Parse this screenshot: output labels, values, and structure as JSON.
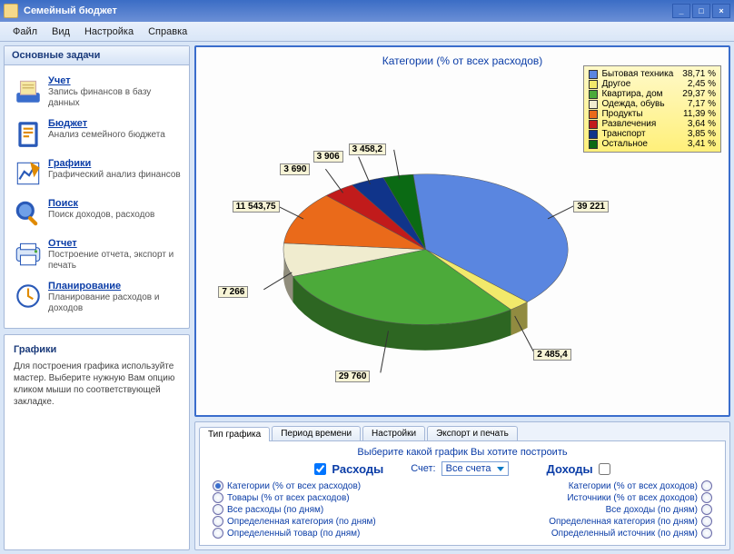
{
  "window": {
    "title": "Семейный бюджет"
  },
  "menu": {
    "items": [
      "Файл",
      "Вид",
      "Настройка",
      "Справка"
    ]
  },
  "tasks_panel": {
    "title": "Основные задачи",
    "items": [
      {
        "title": "Учет",
        "desc": "Запись финансов в базу данных"
      },
      {
        "title": "Бюджет",
        "desc": "Анализ семейного бюджета"
      },
      {
        "title": "Графики",
        "desc": "Графический анализ финансов"
      },
      {
        "title": "Поиск",
        "desc": "Поиск доходов, расходов"
      },
      {
        "title": "Отчет",
        "desc": "Построение отчета, экспорт и печать"
      },
      {
        "title": "Планирование",
        "desc": "Планирование расходов и доходов"
      }
    ]
  },
  "help_panel": {
    "title": "Графики",
    "text": "Для построения графика используйте мастер. Выберите нужную Вам опцию кликом мыши по соответствующей закладке."
  },
  "chart_title": "Категории (% от всех расходов)",
  "chart_data": {
    "type": "pie",
    "title": "Категории (% от всех расходов)",
    "series": [
      {
        "name": "Бытовая техника",
        "percent": 38.71,
        "value": 39221,
        "label": "39 221",
        "color": "#5a86e0"
      },
      {
        "name": "Другое",
        "percent": 2.45,
        "value": 2485.4,
        "label": "2 485,4",
        "color": "#f2e96b"
      },
      {
        "name": "Квартира, дом",
        "percent": 29.37,
        "value": 29760,
        "label": "29 760",
        "color": "#4caa3a"
      },
      {
        "name": "Одежда, обувь",
        "percent": 7.17,
        "value": 7266,
        "label": "7 266",
        "color": "#f0eccf"
      },
      {
        "name": "Продукты",
        "percent": 11.39,
        "value": 11543.75,
        "label": "11 543,75",
        "color": "#ea6a1a"
      },
      {
        "name": "Развлечения",
        "percent": 3.64,
        "value": 3690,
        "label": "3 690",
        "color": "#c11b1b"
      },
      {
        "name": "Транспорт",
        "percent": 3.85,
        "value": 3906,
        "label": "3 906",
        "color": "#10348a"
      },
      {
        "name": "Остальное",
        "percent": 3.41,
        "value": 3458.2,
        "label": "3 458,2",
        "color": "#0b6a14"
      }
    ]
  },
  "legend_header": {
    "name": "",
    "val": ""
  },
  "tabs": {
    "items": [
      "Тип графика",
      "Период времени",
      "Настройки",
      "Экспорт и печать"
    ],
    "active": 0
  },
  "controls": {
    "heading": "Выберите какой график Вы хотите построить",
    "exp_label": "Расходы",
    "inc_label": "Доходы",
    "acct_label": "Счет:",
    "acct_value": "Все счета",
    "exp_checked": true,
    "inc_checked": false,
    "exp_options": [
      "Категории (% от всех расходов)",
      "Товары (% от всех расходов)",
      "Все расходы (по дням)",
      "Определенная категория (по дням)",
      "Определенный товар (по дням)"
    ],
    "exp_selected": 0,
    "inc_options": [
      "Категории (% от всех доходов)",
      "Источники (% от всех доходов)",
      "Все доходы (по дням)",
      "Определенная категория (по дням)",
      "Определенный источник (по дням)"
    ],
    "inc_selected": -1
  }
}
